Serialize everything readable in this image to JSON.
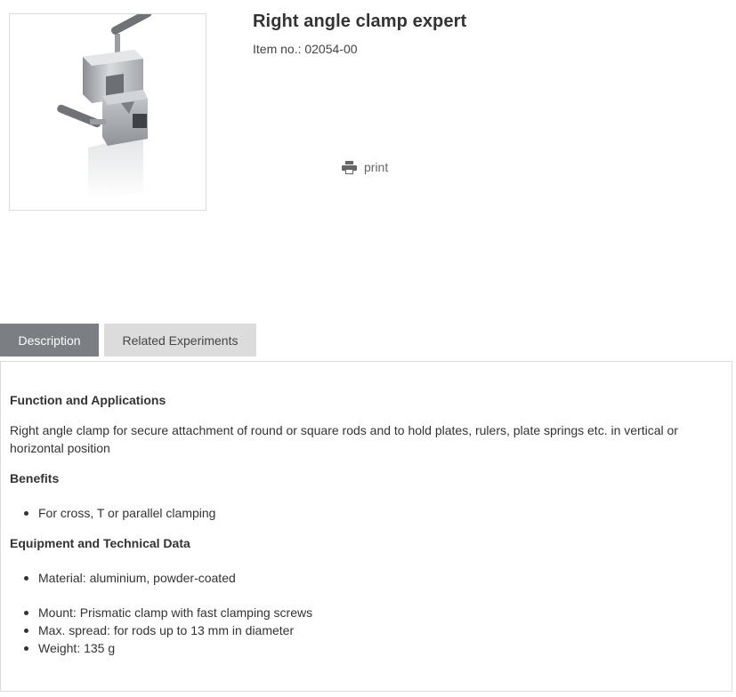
{
  "product": {
    "title": "Right angle clamp expert",
    "item_no": "Item no.: 02054-00",
    "image_alt": "Right angle clamp expert product photo"
  },
  "actions": {
    "print_label": "print",
    "print_icon": "printer-icon"
  },
  "tabs": [
    {
      "label": "Description",
      "active": true
    },
    {
      "label": "Related Experiments",
      "active": false
    }
  ],
  "description": {
    "function_heading": "Function and Applications",
    "function_text": "Right angle clamp for secure attachment of round or square rods and to hold plates, rulers, plate springs etc. in vertical or horizontal position",
    "benefits_heading": "Benefits",
    "benefits": [
      "For cross, T or parallel clamping"
    ],
    "equipment_heading": "Equipment and Technical Data",
    "equipment_group1": [
      "Material: aluminium, powder-coated"
    ],
    "equipment_group2": [
      "Mount: Prismatic clamp with fast clamping screws",
      "Max. spread: for rods up to 13 mm in diameter",
      "Weight: 135 g"
    ]
  },
  "colors": {
    "tab_active_bg": "#7b7e83",
    "tab_inactive_bg": "#dcdcdc",
    "border": "#dcdcdc"
  }
}
